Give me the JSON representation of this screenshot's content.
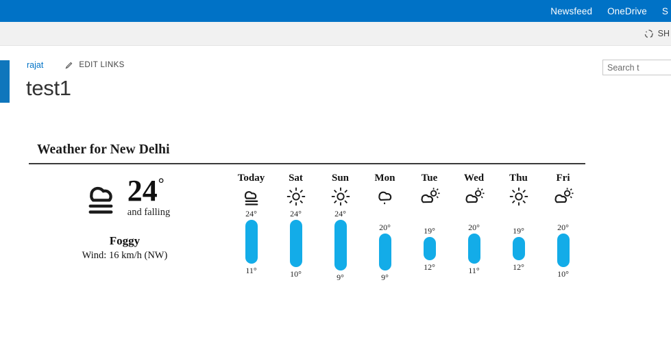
{
  "suitebar": {
    "links": [
      {
        "label": "Newsfeed",
        "name": "suitelink-newsfeed"
      },
      {
        "label": "OneDrive",
        "name": "suitelink-onedrive"
      },
      {
        "label": "S",
        "name": "suitelink-sites"
      }
    ],
    "background": "#0072C6"
  },
  "ribbon": {
    "share_label": "SH",
    "sync_icon": "sync-icon"
  },
  "header": {
    "breadcrumb": "rajat",
    "edit_links_label": "EDIT LINKS",
    "pencil_icon": "pencil-icon",
    "page_title": "test1",
    "accent_color": "#0F76BC"
  },
  "search": {
    "placeholder": "Search t",
    "value": ""
  },
  "weather": {
    "title": "Weather for New Delhi",
    "bar_color": "#13ACE8",
    "current": {
      "icon": "fog-icon",
      "temperature": "24",
      "degree": "°",
      "trend": "and falling",
      "condition": "Foggy",
      "wind": "Wind: 16 km/h (NW)"
    },
    "scale": {
      "max": 24,
      "min": 9
    },
    "forecast": [
      {
        "day": "Today",
        "icon": "fog-icon",
        "high": "24°",
        "low": "11°",
        "high_val": 24,
        "low_val": 11
      },
      {
        "day": "Sat",
        "icon": "sunny-icon",
        "high": "24°",
        "low": "10°",
        "high_val": 24,
        "low_val": 10
      },
      {
        "day": "Sun",
        "icon": "sunny-icon",
        "high": "24°",
        "low": "9°",
        "high_val": 24,
        "low_val": 9
      },
      {
        "day": "Mon",
        "icon": "rain-cloud-icon",
        "high": "20°",
        "low": "9°",
        "high_val": 20,
        "low_val": 9
      },
      {
        "day": "Tue",
        "icon": "partly-cloudy-icon",
        "high": "19°",
        "low": "12°",
        "high_val": 19,
        "low_val": 12
      },
      {
        "day": "Wed",
        "icon": "partly-cloudy-icon",
        "high": "20°",
        "low": "11°",
        "high_val": 20,
        "low_val": 11
      },
      {
        "day": "Thu",
        "icon": "sunny-icon",
        "high": "19°",
        "low": "12°",
        "high_val": 19,
        "low_val": 12
      },
      {
        "day": "Fri",
        "icon": "partly-cloudy-icon",
        "high": "20°",
        "low": "10°",
        "high_val": 20,
        "low_val": 10
      }
    ]
  }
}
